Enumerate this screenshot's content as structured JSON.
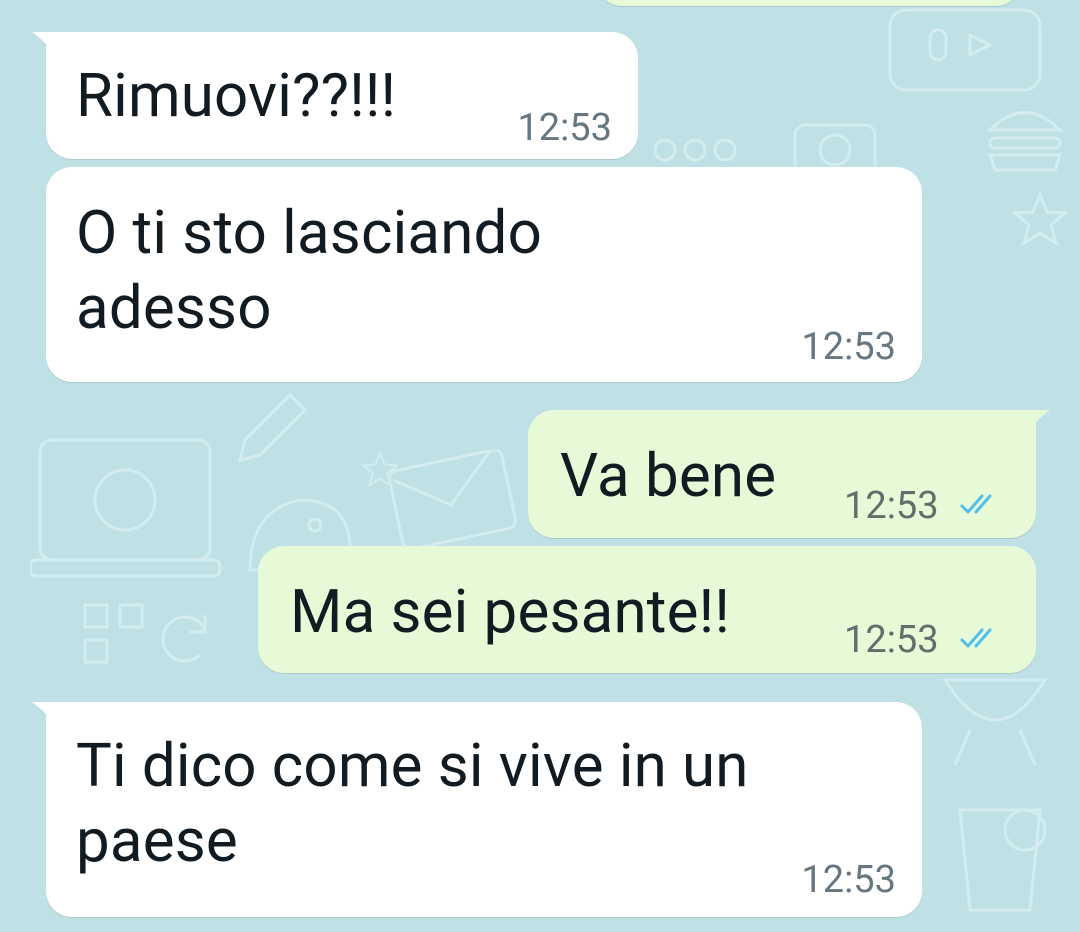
{
  "chat": {
    "messages": [
      {
        "id": "m1",
        "direction": "incoming",
        "text": "Rimuovi??!!!",
        "time": "12:53"
      },
      {
        "id": "m2",
        "direction": "incoming",
        "text": "O ti sto lasciando\nadesso",
        "time": "12:53"
      },
      {
        "id": "m3",
        "direction": "outgoing",
        "text": "Va bene",
        "time": "12:53",
        "status": "read"
      },
      {
        "id": "m4",
        "direction": "outgoing",
        "text": "Ma sei pesante!!",
        "time": "12:53",
        "status": "read"
      },
      {
        "id": "m5",
        "direction": "incoming",
        "text": "Ti dico come si vive in un\npaese",
        "time": "12:53"
      }
    ]
  },
  "colors": {
    "background": "#bfe1e5",
    "incoming_bubble": "#ffffff",
    "outgoing_bubble": "#e7fad7",
    "read_ticks": "#53bdeb",
    "timestamp": "#667781"
  },
  "icons": {
    "read_status": "double-check-icon"
  }
}
